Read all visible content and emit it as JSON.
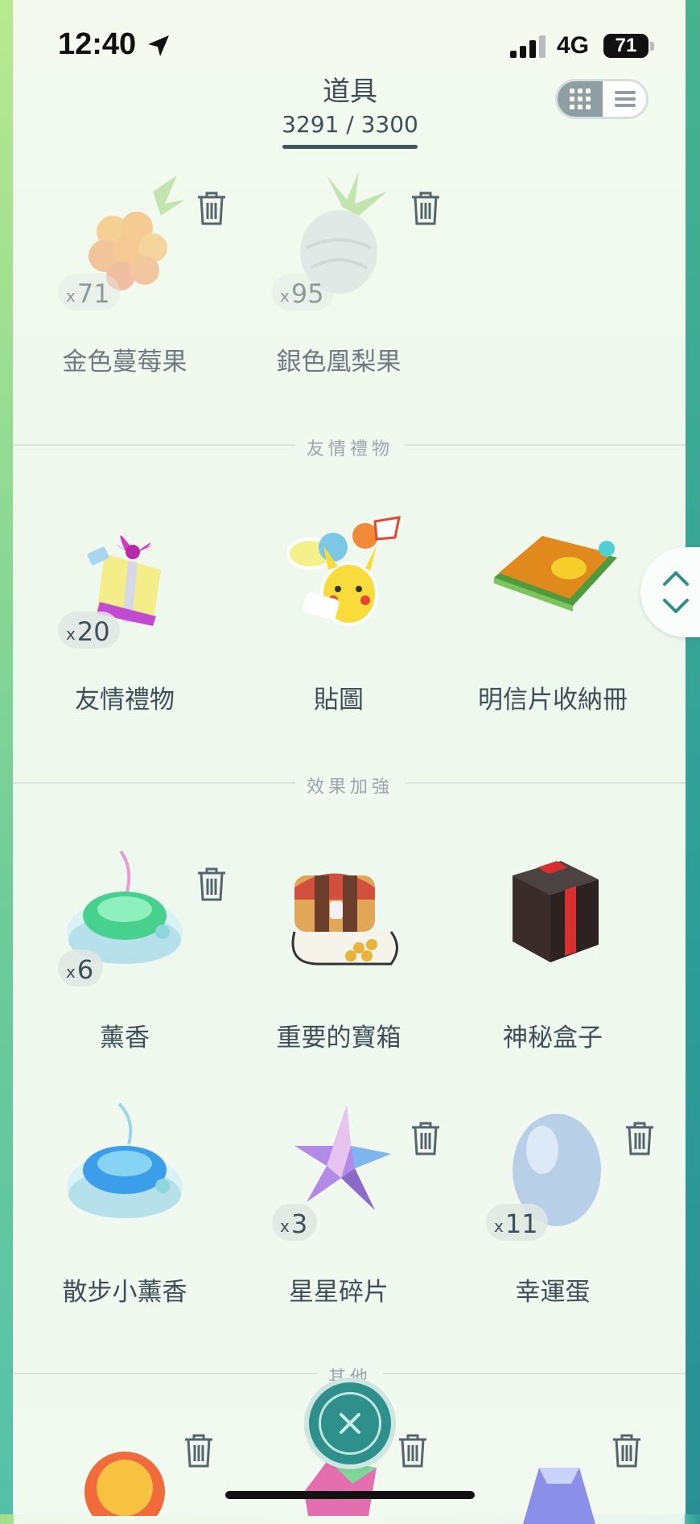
{
  "status_bar": {
    "time": "12:40",
    "network": "4G",
    "battery": "71"
  },
  "header": {
    "title": "道具",
    "count": "3291 / 3300"
  },
  "view_toggle": {
    "selected": "grid"
  },
  "sections": {
    "friendship": "友情禮物",
    "boosts": "效果加強",
    "other": "其他"
  },
  "items": [
    {
      "name": "金色蔓莓果",
      "quantity": "71",
      "icon": "golden-razz-berry-icon"
    },
    {
      "name": "銀色凰梨果",
      "quantity": "95",
      "icon": "silver-pinap-berry-icon"
    },
    {
      "name": "友情禮物",
      "quantity": "20",
      "icon": "gift-icon"
    },
    {
      "name": "貼圖",
      "icon": "sticker-icon"
    },
    {
      "name": "明信片收納冊",
      "icon": "postcard-book-icon"
    },
    {
      "name": "薰香",
      "quantity": "6",
      "icon": "incense-icon"
    },
    {
      "name": "重要的寶箱",
      "icon": "treasure-chest-icon"
    },
    {
      "name": "神秘盒子",
      "icon": "mystery-box-icon"
    },
    {
      "name": "散步小薰香",
      "icon": "daily-adventure-incense-icon"
    },
    {
      "name": "星星碎片",
      "quantity": "3",
      "icon": "star-piece-icon"
    },
    {
      "name": "幸運蛋",
      "quantity": "11",
      "icon": "lucky-egg-icon"
    }
  ],
  "colors": {
    "text": "#3f4f57",
    "accent": "#2f8f8a"
  },
  "badge_prefix": "x"
}
